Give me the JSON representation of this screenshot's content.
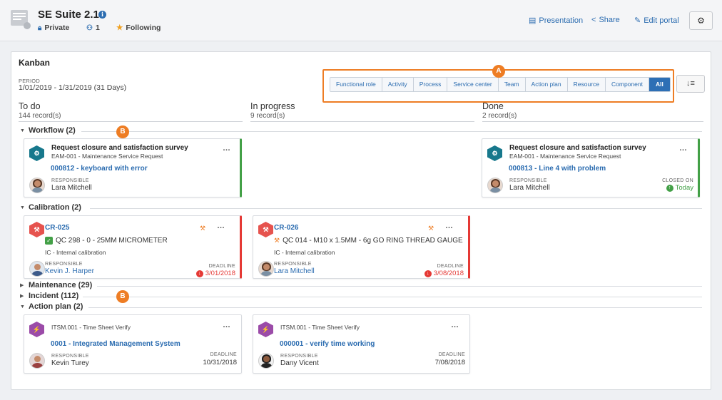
{
  "header": {
    "title": "SE Suite 2.1",
    "privacy": "Private",
    "members": "1",
    "following": "Following",
    "links": {
      "presentation": "Presentation",
      "share": "Share",
      "edit_portal": "Edit portal"
    }
  },
  "panel": {
    "title": "Kanban",
    "period_label": "PERIOD",
    "period_value": "1/01/2019 - 1/31/2019 (31 Days)"
  },
  "filter": {
    "options": [
      "Functional role",
      "Activity",
      "Process",
      "Service center",
      "Team",
      "Action plan",
      "Resource",
      "Component",
      "All"
    ],
    "selected": "All"
  },
  "callouts": {
    "a": "A",
    "b": "B"
  },
  "columns": [
    {
      "title": "To do",
      "count": "144 record(s)"
    },
    {
      "title": "In progress",
      "count": "9 record(s)"
    },
    {
      "title": "Done",
      "count": "2 record(s)"
    }
  ],
  "groups": {
    "workflow": "Workflow (2)",
    "calibration": "Calibration (2)",
    "maintenance": "Maintenance (29)",
    "incident": "Incident (112)",
    "action_plan": "Action plan (2)"
  },
  "cards": {
    "wf1": {
      "title": "Request closure and satisfaction survey",
      "sub": "EAM-001 - Maintenance Service Request",
      "link": "000812 - keyboard with error",
      "resp_label": "RESPONSIBLE",
      "resp": "Lara Mitchell"
    },
    "wf2": {
      "title": "Request closure and satisfaction survey",
      "sub": "EAM-001 - Maintenance Service Request",
      "link": "000813 - Line 4 with problem",
      "resp_label": "RESPONSIBLE",
      "resp": "Lara Mitchell",
      "closed_label": "CLOSED ON",
      "closed": "Today"
    },
    "cal1": {
      "code": "CR-025",
      "item": "QC 298 - 0 - 25MM MICROMETER",
      "sub": "IC - Internal calibration",
      "resp_label": "RESPONSIBLE",
      "resp": "Kevin J. Harper",
      "dl_label": "DEADLINE",
      "deadline": "3/01/2018"
    },
    "cal2": {
      "code": "CR-026",
      "item": "QC 014 - M10 x 1.5MM - 6g GO RING THREAD GAUGE",
      "sub": "IC - Internal calibration",
      "resp_label": "RESPONSIBLE",
      "resp": "Lara Mitchell",
      "dl_label": "DEADLINE",
      "deadline": "3/08/2018"
    },
    "ap1": {
      "sub": "ITSM.001 - Time Sheet Verify",
      "link": "0001 - Integrated Management System",
      "resp_label": "RESPONSIBLE",
      "resp": "Kevin Turey",
      "dl_label": "DEADLINE",
      "deadline": "10/31/2018"
    },
    "ap2": {
      "sub": "ITSM.001 - Time Sheet Verify",
      "link": "000001 - verify time working",
      "resp_label": "RESPONSIBLE",
      "resp": "Dany Vicent",
      "dl_label": "DEADLINE",
      "deadline": "7/08/2018"
    }
  },
  "colors": {
    "accent": "#2b6cb0",
    "callout": "#ee7d24",
    "green": "#43a047",
    "red": "#e53935"
  }
}
